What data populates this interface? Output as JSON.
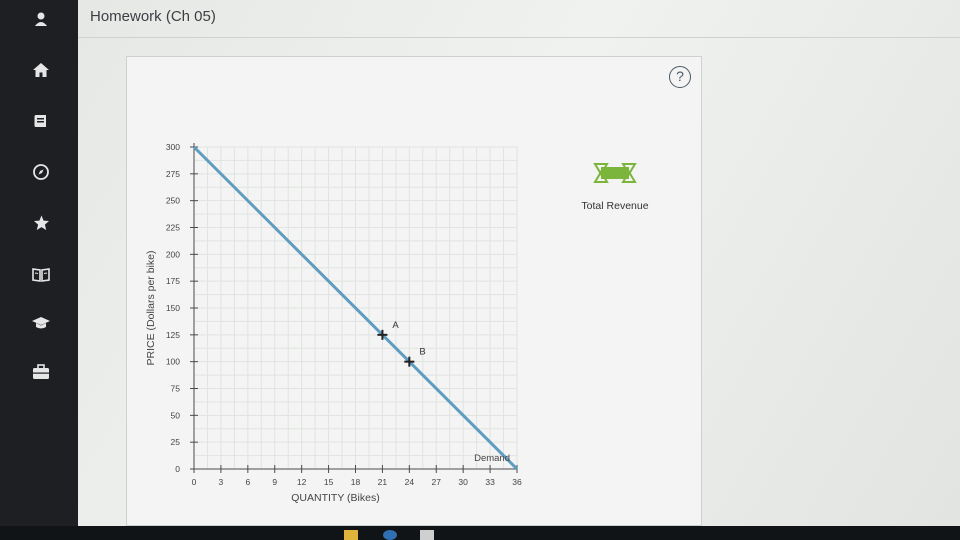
{
  "app": {
    "title": "Homework (Ch 05)"
  },
  "sidebar": {
    "items": [
      {
        "icon": "user-icon"
      },
      {
        "icon": "home-icon"
      },
      {
        "icon": "book-icon"
      },
      {
        "icon": "compass-icon"
      },
      {
        "icon": "star-icon"
      },
      {
        "icon": "open-book-icon"
      },
      {
        "icon": "graduation-cap-icon"
      },
      {
        "icon": "briefcase-icon"
      }
    ]
  },
  "panel": {
    "help_label": "?"
  },
  "chart_data": {
    "type": "line",
    "xlabel": "QUANTITY (Bikes)",
    "ylabel": "PRICE (Dollars per bike)",
    "xlim": [
      0,
      36
    ],
    "ylim": [
      0,
      300
    ],
    "xticks": [
      0,
      3,
      6,
      9,
      12,
      15,
      18,
      21,
      24,
      27,
      30,
      33,
      36
    ],
    "yticks": [
      0,
      25,
      50,
      75,
      100,
      125,
      150,
      175,
      200,
      225,
      250,
      275,
      300
    ],
    "grid": true,
    "series": [
      {
        "name": "Demand",
        "x": [
          0,
          36
        ],
        "y": [
          300,
          0
        ],
        "color": "#5e9cc0"
      }
    ],
    "points": [
      {
        "label": "A",
        "x": 21,
        "y": 125
      },
      {
        "label": "B",
        "x": 24,
        "y": 100
      }
    ],
    "legend": {
      "label": "Total Revenue",
      "color": "#7cb53b"
    }
  },
  "colors": {
    "accent_demand": "#5e9cc0",
    "legend_green": "#7cb53b",
    "sidebar_bg": "#1d1f23"
  }
}
